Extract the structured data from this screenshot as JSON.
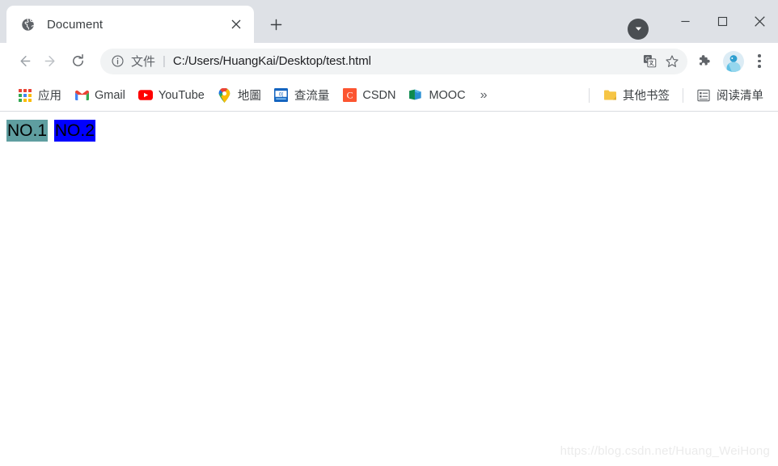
{
  "window": {
    "tab_search_icon": "chevron-down-circle-icon",
    "minimize_label": "—",
    "maximize_label": "□",
    "close_label": "✕"
  },
  "tabs": [
    {
      "title": "Document",
      "favicon": "globe-icon",
      "close_label": "✕",
      "active": true
    }
  ],
  "new_tab": {
    "label": "+",
    "icon": "plus-icon"
  },
  "toolbar": {
    "back_icon": "arrow-left-icon",
    "forward_icon": "arrow-right-icon",
    "reload_icon": "reload-icon",
    "omnibox": {
      "info_icon": "info-circle-icon",
      "scheme_label": "文件",
      "separator": "|",
      "url": "C:/Users/HuangKai/Desktop/test.html"
    },
    "translate_icon": "translate-icon",
    "bookmark_star_icon": "star-outline-icon",
    "extensions_icon": "puzzle-piece-icon",
    "profile_icon": "avatar-icon",
    "menu_icon": "three-dots-vertical-icon"
  },
  "bookmarks_bar": {
    "items": [
      {
        "label": "应用",
        "icon": "apps-grid-icon"
      },
      {
        "label": "Gmail",
        "icon": "gmail-icon"
      },
      {
        "label": "YouTube",
        "icon": "youtube-icon"
      },
      {
        "label": "地圖",
        "icon": "maps-pin-icon"
      },
      {
        "label": "查流量",
        "icon": "traffic-meter-icon"
      },
      {
        "label": "CSDN",
        "icon": "csdn-icon"
      },
      {
        "label": "MOOC",
        "icon": "mooc-icon"
      }
    ],
    "overflow_label": "»",
    "other_bookmarks": {
      "label": "其他书签",
      "icon": "folder-icon"
    },
    "reading_list": {
      "label": "阅读清单",
      "icon": "reading-list-icon"
    }
  },
  "page": {
    "marks": [
      {
        "text": "NO.1",
        "background": "#5f9ea0"
      },
      {
        "text": "NO.2",
        "background": "#0000ff"
      }
    ],
    "watermark": "https://blog.csdn.net/Huang_WeiHong"
  },
  "colors": {
    "tab_strip_bg": "#dee1e6",
    "toolbar_bg": "#ffffff",
    "omnibox_bg": "#f1f3f4",
    "mark1_bg": "#5f9ea0",
    "mark2_bg": "#0000ff",
    "watermark": "#ebebeb"
  }
}
